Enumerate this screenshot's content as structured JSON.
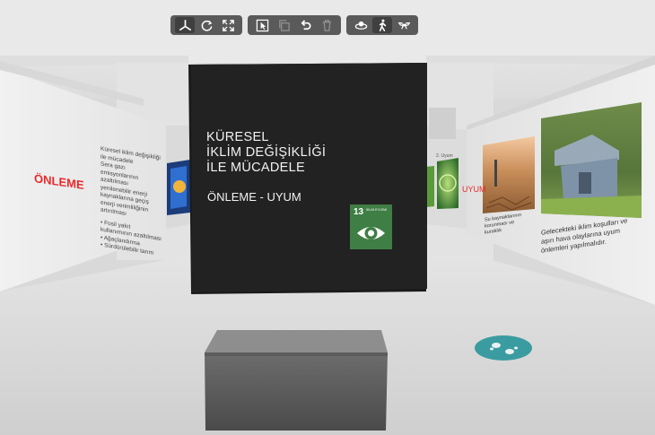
{
  "toolbar": {
    "groups": [
      [
        {
          "name": "axis-view-icon",
          "active": true,
          "disabled": false
        },
        {
          "name": "rotate-icon",
          "active": false,
          "disabled": false
        },
        {
          "name": "fullscreen-icon",
          "active": false,
          "disabled": false
        }
      ],
      [
        {
          "name": "select-icon",
          "active": false,
          "disabled": false
        },
        {
          "name": "copy-icon",
          "active": false,
          "disabled": true
        },
        {
          "name": "undo-icon",
          "active": false,
          "disabled": false
        },
        {
          "name": "delete-icon",
          "active": false,
          "disabled": true
        }
      ],
      [
        {
          "name": "orbit-icon",
          "active": false,
          "disabled": false
        },
        {
          "name": "walk-icon",
          "active": true,
          "disabled": false
        },
        {
          "name": "drone-icon",
          "active": false,
          "disabled": false
        }
      ]
    ]
  },
  "center_panel": {
    "title_line1": "KÜRESEL",
    "title_line2": "İKLİM DEĞİŞİKLİĞİ",
    "title_line3": "İLE MÜCADELE",
    "subtitle": "ÖNLEME - UYUM",
    "sdg_number": "13",
    "sdg_label": "İKLİM EYLEMİ",
    "sdg_color": "#3f7e44"
  },
  "left_wall": {
    "heading": "ÖNLEME",
    "text_lines": [
      "Küresel iklim değişikliği ile mücadele",
      "Sera gazı emisyonlarının azaltılması",
      "yenilenebilir enerji kaynaklarına geçiş",
      "enerji verimliliğinin artırılması",
      "",
      "• Fosil yakıt kullanımının azaltılması",
      "• Ağaçlandırma",
      "• Sürdürülebilir tarım"
    ]
  },
  "right_wall": {
    "heading": "UYUM",
    "small_heading": "2. Uyum",
    "caption_drought": "Su kaynaklarının korunması ve kuraklık",
    "caption_main": "Gelecekteki iklim koşulları ve aşırı hava olaylarına uyum önlemleri yapılmalıdır."
  },
  "floor": {
    "footprint_color": "#3a9ca0"
  }
}
